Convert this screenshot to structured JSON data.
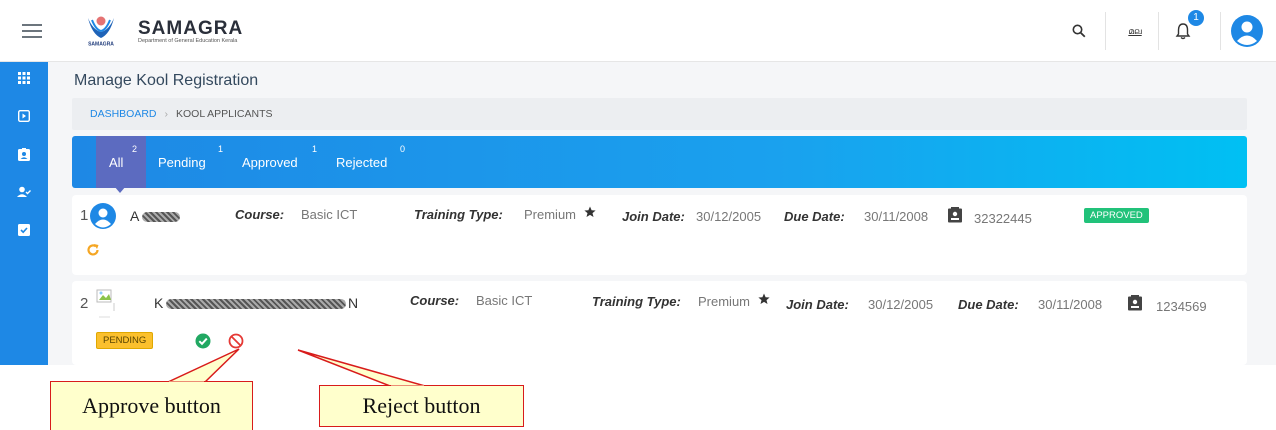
{
  "header": {
    "brand_name": "SAMAGRA",
    "brand_subtitle": "Department of General Education Kerala",
    "logo_text": "SAMAGRA",
    "notification_count": "1",
    "language_label": "മല"
  },
  "page": {
    "title": "Manage Kool Registration"
  },
  "breadcrumb": {
    "home": "DASHBOARD",
    "separator": "›",
    "current": "KOOL APPLICANTS"
  },
  "tabs": [
    {
      "label": "All",
      "count": "2"
    },
    {
      "label": "Pending",
      "count": "1"
    },
    {
      "label": "Approved",
      "count": "1"
    },
    {
      "label": "Rejected",
      "count": "0"
    }
  ],
  "applicants": [
    {
      "number": "1",
      "name_visible": "A",
      "course_label": "Course:",
      "course": "Basic ICT",
      "training_label": "Training Type:",
      "training": "Premium",
      "join_label": "Join Date:",
      "join_date": "30/12/2005",
      "due_label": "Due Date:",
      "due_date": "30/11/2008",
      "id_number": "32322445",
      "status": "APPROVED"
    },
    {
      "number": "2",
      "name_visible_start": "K",
      "name_visible_end": "N",
      "course_label": "Course:",
      "course": "Basic ICT",
      "training_label": "Training Type:",
      "training": "Premium",
      "join_label": "Join Date:",
      "join_date": "30/12/2005",
      "due_label": "Due Date:",
      "due_date": "30/11/2008",
      "id_number": "1234569",
      "status": "PENDING"
    }
  ],
  "callouts": {
    "approve": "Approve button",
    "reject": "Reject button"
  },
  "colors": {
    "primary": "#1e88e5",
    "active_tab": "#5c6bc0",
    "approved": "#21c27a",
    "pending": "#fbc02d",
    "approve_icon": "#21a862",
    "reject_icon": "#e53935",
    "refresh_icon": "#f5a623",
    "callout_border": "#d81b1b",
    "callout_fill": "#ffffcc"
  },
  "icons": {
    "menu": "hamburger-icon",
    "search": "search-icon",
    "language": "language-icon",
    "notifications": "bell-icon",
    "profile": "user-avatar-icon",
    "star": "star-icon",
    "id_card": "id-card-icon",
    "refresh": "refresh-icon",
    "approve": "check-circle-icon",
    "reject": "block-icon"
  }
}
